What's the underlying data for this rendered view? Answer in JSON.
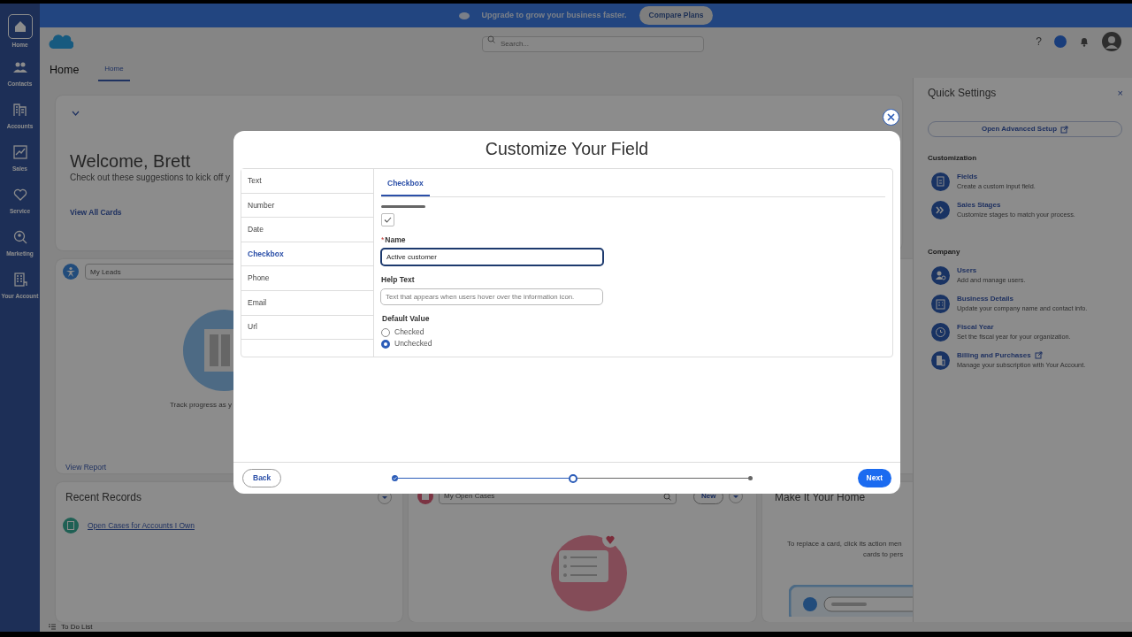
{
  "nav": [
    {
      "label": "Home",
      "selected": true
    },
    {
      "label": "Contacts",
      "selected": false
    },
    {
      "label": "Accounts",
      "selected": false
    },
    {
      "label": "Sales",
      "selected": false
    },
    {
      "label": "Service",
      "selected": false
    },
    {
      "label": "Marketing",
      "selected": false
    },
    {
      "label": "Your Account",
      "selected": false
    }
  ],
  "banner": {
    "text": "Upgrade to grow your business faster.",
    "button": "Compare Plans"
  },
  "header": {
    "search_placeholder": "Search...",
    "help": "?",
    "page_title": "Home",
    "tabs": [
      {
        "label": "Home",
        "selected": true
      }
    ]
  },
  "welcome": {
    "title": "Welcome, Brett",
    "subtitle": "Check out these suggestions to kick off y",
    "link": "View All Cards"
  },
  "leads_card": {
    "select": "My Leads",
    "caption": "Track progress as y",
    "link": "View Report"
  },
  "recent_records": {
    "title": "Recent Records",
    "items": [
      "Open Cases for Accounts I Own"
    ]
  },
  "cases_card": {
    "select": "My Open Cases",
    "button": "New"
  },
  "home_card": {
    "title": "Make It Your Home",
    "lines": [
      "To replace a card, click its action men",
      "cards to pers"
    ]
  },
  "todo": {
    "label": "To Do List"
  },
  "quick_settings": {
    "title": "Quick Settings",
    "close": "×",
    "button": {
      "label": "Open Advanced Setup",
      "external": true
    },
    "sections": [
      {
        "title": "Customization",
        "items": [
          {
            "kind": "fields",
            "title": "Fields",
            "description": "Create a custom input field.",
            "external": false
          },
          {
            "kind": "stages",
            "title": "Sales Stages",
            "description": "Customize stages to match your process.",
            "external": false
          }
        ]
      },
      {
        "title": "Company",
        "items": [
          {
            "kind": "users",
            "title": "Users",
            "description": "Add and manage users.",
            "external": false
          },
          {
            "kind": "business",
            "title": "Business Details",
            "description": "Update your company name and contact info.",
            "external": false
          },
          {
            "kind": "fiscal",
            "title": "Fiscal Year",
            "description": "Set the fiscal year for your organization.",
            "external": false
          },
          {
            "kind": "billing",
            "title": "Billing and Purchases",
            "description": "Manage your subscription with Your Account.",
            "external": true
          }
        ]
      }
    ]
  },
  "modal": {
    "title": "Customize Your Field",
    "field_types": [
      {
        "label": "Text",
        "selected": false
      },
      {
        "label": "Number",
        "selected": false
      },
      {
        "label": "Date",
        "selected": false
      },
      {
        "label": "Checkbox",
        "selected": true
      },
      {
        "label": "Phone",
        "selected": false
      },
      {
        "label": "Email",
        "selected": false
      },
      {
        "label": "Url",
        "selected": false
      }
    ],
    "tabs": [
      {
        "label": "Checkbox",
        "selected": true
      }
    ],
    "preview": {
      "checked": true
    },
    "required_mark": "*",
    "name_label": "Name",
    "name_value": "Active customer",
    "help_label": "Help Text",
    "help_placeholder": "Text that appears when users hover over the information icon.",
    "default_label": "Default Value",
    "default_options": [
      {
        "label": "Checked",
        "selected": false
      },
      {
        "label": "Unchecked",
        "selected": true
      }
    ],
    "back": "Back",
    "next": "Next",
    "steps": [
      {
        "kind": "complete"
      },
      {
        "kind": "current"
      },
      {
        "kind": "incomplete"
      }
    ]
  }
}
